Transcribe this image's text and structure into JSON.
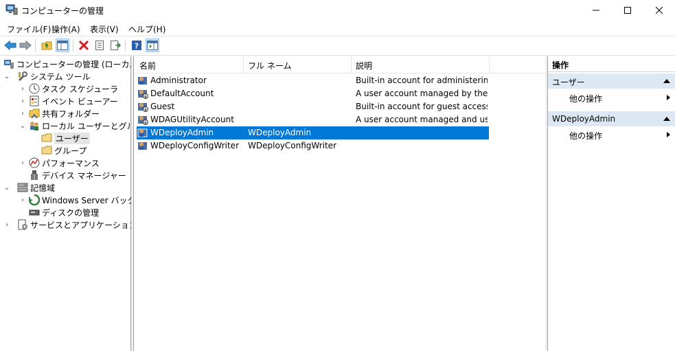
{
  "window": {
    "title": "コンピューターの管理"
  },
  "menu": [
    "ファイル(F)",
    "操作(A)",
    "表示(V)",
    "ヘルプ(H)"
  ],
  "tree": {
    "root": "コンピューターの管理 (ローカル)",
    "system_tools": "システム ツール",
    "task_scheduler": "タスク スケジューラ",
    "event_viewer": "イベント ビューアー",
    "shared_folders": "共有フォルダー",
    "local_users_groups": "ローカル ユーザーとグループ",
    "users": "ユーザー",
    "groups": "グループ",
    "performance": "パフォーマンス",
    "device_manager": "デバイス マネージャー",
    "storage": "記憶域",
    "windows_server_backup": "Windows Server バックア",
    "disk_management": "ディスクの管理",
    "services_apps": "サービスとアプリケーション"
  },
  "list": {
    "columns": [
      "名前",
      "フル ネーム",
      "説明"
    ],
    "rows": [
      {
        "name": "Administrator",
        "full_name": "",
        "description": "Built-in account for administering..."
      },
      {
        "name": "DefaultAccount",
        "full_name": "",
        "description": "A user account managed by the s..."
      },
      {
        "name": "Guest",
        "full_name": "",
        "description": "Built-in account for guest access t..."
      },
      {
        "name": "WDAGUtilityAccount",
        "full_name": "",
        "description": "A user account managed and use..."
      },
      {
        "name": "WDeployAdmin",
        "full_name": "WDeployAdmin",
        "description": ""
      },
      {
        "name": "WDeployConfigWriter",
        "full_name": "WDeployConfigWriter",
        "description": ""
      }
    ],
    "selected": "WDeployAdmin"
  },
  "actions": {
    "header": "操作",
    "section1": {
      "title": "ユーザー",
      "item": "他の操作"
    },
    "section2": {
      "title": "WDeployAdmin",
      "item": "他の操作"
    }
  },
  "colors": {
    "selection": "#0078d7",
    "action_section": "#dce9f5"
  }
}
